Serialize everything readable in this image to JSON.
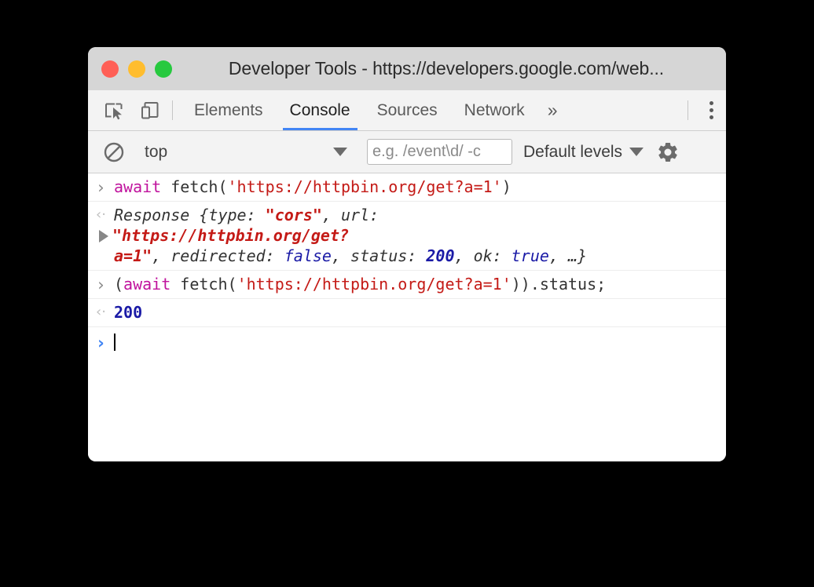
{
  "window": {
    "title": "Developer Tools - https://developers.google.com/web...",
    "traffic_lights": [
      {
        "name": "close",
        "color": "#ff5f56"
      },
      {
        "name": "minimize",
        "color": "#ffbd2e"
      },
      {
        "name": "maximize",
        "color": "#27c93f"
      }
    ]
  },
  "tabbar": {
    "inspect_icon": "inspect-element-icon",
    "device_icon": "device-toolbar-icon",
    "tabs": [
      {
        "label": "Elements",
        "active": false
      },
      {
        "label": "Console",
        "active": true
      },
      {
        "label": "Sources",
        "active": false
      },
      {
        "label": "Network",
        "active": false
      }
    ],
    "overflow_label": "»",
    "menu_icon": "kebab-menu-icon",
    "active_underline_color": "#4285f4"
  },
  "console_toolbar": {
    "clear_icon": "clear-console-icon",
    "context": "top",
    "context_caret": "chevron-down-icon",
    "filter_placeholder": "e.g. /event\\d/ -c",
    "filter_value": "",
    "levels_label": "Default levels",
    "levels_caret": "chevron-down-icon",
    "settings_icon": "gear-icon"
  },
  "console": {
    "messages": [
      {
        "type": "input",
        "gutter": "›",
        "tokens": [
          {
            "t": "await",
            "c": "kw"
          },
          {
            "t": " fetch(",
            "c": "plain"
          },
          {
            "t": "'https://httpbin.org/get?a=1'",
            "c": "str"
          },
          {
            "t": ")",
            "c": "plain"
          }
        ]
      },
      {
        "type": "output-object",
        "gutter": "‹·",
        "line1": [
          {
            "t": "Response ",
            "c": "objname"
          },
          {
            "t": "{type: ",
            "c": "plain"
          },
          {
            "t": "\"cors\"",
            "c": "str"
          },
          {
            "t": ", url:",
            "c": "plain"
          }
        ],
        "line2": [
          {
            "t": "\"https://httpbin.org/get?",
            "c": "str"
          }
        ],
        "line3": [
          {
            "t": "a=1\"",
            "c": "str"
          },
          {
            "t": ", redirected: ",
            "c": "plain"
          },
          {
            "t": "false",
            "c": "bool"
          },
          {
            "t": ", status: ",
            "c": "plain"
          },
          {
            "t": "200",
            "c": "num"
          },
          {
            "t": ", ok: ",
            "c": "plain"
          },
          {
            "t": "true",
            "c": "bool"
          },
          {
            "t": ", …}",
            "c": "plain"
          }
        ],
        "expander": "expand-triangle-icon"
      },
      {
        "type": "input",
        "gutter": "›",
        "tokens": [
          {
            "t": "(",
            "c": "plain"
          },
          {
            "t": "await",
            "c": "kw"
          },
          {
            "t": " fetch(",
            "c": "plain"
          },
          {
            "t": "'https://httpbin.org/get?a=1'",
            "c": "str"
          },
          {
            "t": ")).status;",
            "c": "plain"
          }
        ]
      },
      {
        "type": "output-value",
        "gutter": "‹·",
        "value": "200"
      }
    ],
    "prompt": {
      "gutter": "›",
      "value": ""
    }
  },
  "colors": {
    "accent": "#4285f4",
    "keyword": "#c0139d",
    "string": "#c41a16",
    "number": "#1a1aa6",
    "titlebar": "#d6d6d6",
    "toolbar": "#f3f3f3"
  }
}
